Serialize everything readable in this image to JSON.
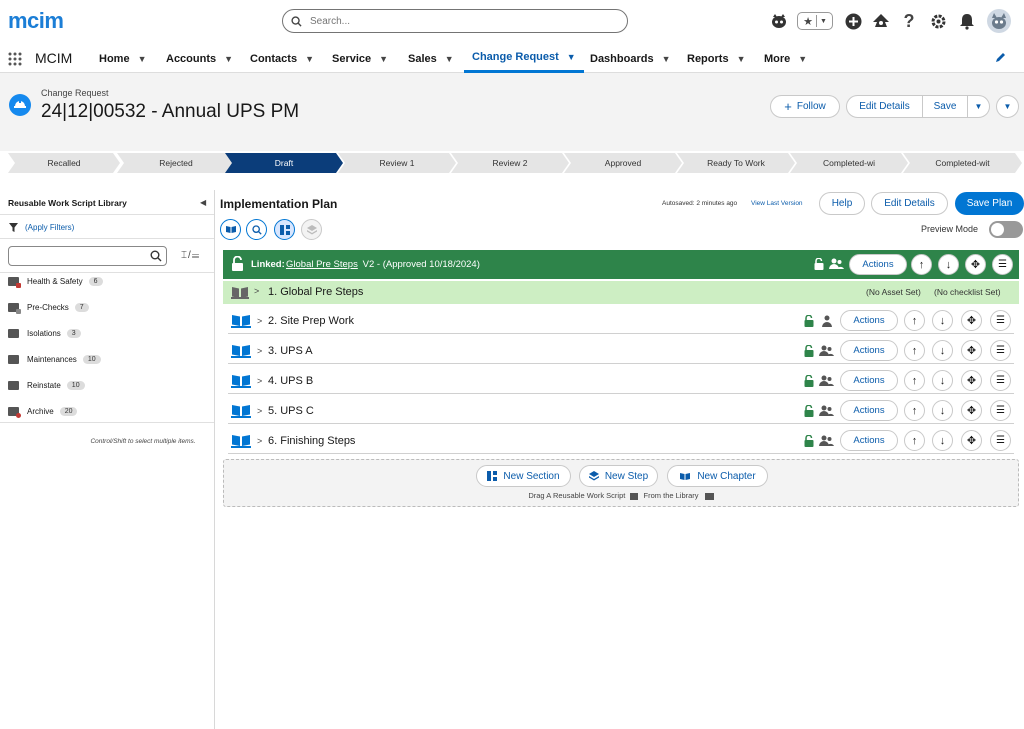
{
  "header": {
    "logo_text": "mcim",
    "search_placeholder": "Search...",
    "icons": [
      "avatar-mascot-icon",
      "favorites-star-icon",
      "favorites-menu-icon",
      "plus-icon",
      "trailhead-icon",
      "help-icon",
      "settings-gear-icon",
      "notifications-bell-icon",
      "user-avatar-icon"
    ]
  },
  "nav": {
    "app_name": "MCIM",
    "items": [
      {
        "label": "Home",
        "active": false
      },
      {
        "label": "Accounts",
        "active": false
      },
      {
        "label": "Contacts",
        "active": false
      },
      {
        "label": "Service",
        "active": false
      },
      {
        "label": "Sales",
        "active": false
      },
      {
        "label": "Change Request",
        "active": true
      },
      {
        "label": "Dashboards",
        "active": false
      },
      {
        "label": "Reports",
        "active": false
      },
      {
        "label": "More",
        "active": false
      }
    ]
  },
  "record": {
    "object_label": "Change Request",
    "title": "24|12|00532 - Annual UPS PM",
    "buttons": {
      "follow": "Follow",
      "edit_details": "Edit Details",
      "save": "Save"
    }
  },
  "path": {
    "stages": [
      "Recalled",
      "Rejected",
      "Draft",
      "Review 1",
      "Review 2",
      "Approved",
      "Ready To Work",
      "Completed-wi",
      "Completed-wit"
    ],
    "current": "Draft"
  },
  "library": {
    "title": "Reusable Work Script Library",
    "apply_filters": "(Apply Filters)",
    "search_value": "",
    "folders": [
      {
        "name": "Health & Safety",
        "count": "6",
        "icon": "folder-locked-icon"
      },
      {
        "name": "Pre-Checks",
        "count": "7",
        "icon": "folder-locked-icon"
      },
      {
        "name": "Isolations",
        "count": "3",
        "icon": "folder-icon"
      },
      {
        "name": "Maintenances",
        "count": "10",
        "icon": "folder-icon"
      },
      {
        "name": "Reinstate",
        "count": "10",
        "icon": "folder-icon"
      },
      {
        "name": "Archive",
        "count": "20",
        "icon": "folder-archive-icon"
      }
    ],
    "hint": "Control/Shift to select multiple items."
  },
  "plan": {
    "title": "Implementation Plan",
    "autosaved": "Autosaved: 2 minutes ago",
    "view_last_version": "View Last Version",
    "help": "Help",
    "edit_details": "Edit Details",
    "save_plan": "Save Plan",
    "preview_mode": "Preview Mode",
    "linked": {
      "prefix": "Linked:",
      "link_text": "Global Pre Steps",
      "suffix": " V2 - (Approved 10/18/2024)",
      "actions": "Actions"
    },
    "global_row": {
      "label": "1. Global Pre Steps",
      "no_asset": "(No Asset Set)",
      "no_checklist": "(No checklist Set)"
    },
    "sections": [
      {
        "label": "2. Site Prep Work",
        "actions": "Actions"
      },
      {
        "label": "3. UPS A",
        "actions": "Actions"
      },
      {
        "label": "4. UPS B",
        "actions": "Actions"
      },
      {
        "label": "5. UPS C",
        "actions": "Actions"
      },
      {
        "label": "6. Finishing Steps",
        "actions": "Actions"
      }
    ],
    "new_section": "New Section",
    "new_step": "New Step",
    "new_chapter": "New Chapter",
    "drag_prefix": "Drag A Reusable Work Script",
    "drag_suffix": "From the Library"
  },
  "colors": {
    "brand_blue": "#0176d3",
    "linked_green": "#2e844a",
    "global_row_green": "#cdeec3",
    "path_current": "#0b3d7a"
  }
}
